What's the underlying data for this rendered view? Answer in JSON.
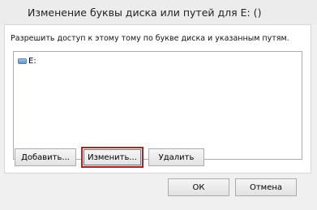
{
  "window": {
    "title": "Изменение буквы диска или путей для E: ()"
  },
  "panel": {
    "description": "Разрешить доступ к этому тому по букве диска и указанным путям.",
    "list_items": [
      {
        "label": "E:",
        "icon": "drive-icon"
      }
    ]
  },
  "buttons": {
    "add_label": "Добавить...",
    "change_label": "Изменить...",
    "delete_label": "Удалить",
    "ok_label": "ОК",
    "cancel_label": "Отмена"
  },
  "colors": {
    "focus_border": "#a2272b",
    "panel_bg": "#ffffff",
    "window_bg": "#f0f0f0"
  }
}
